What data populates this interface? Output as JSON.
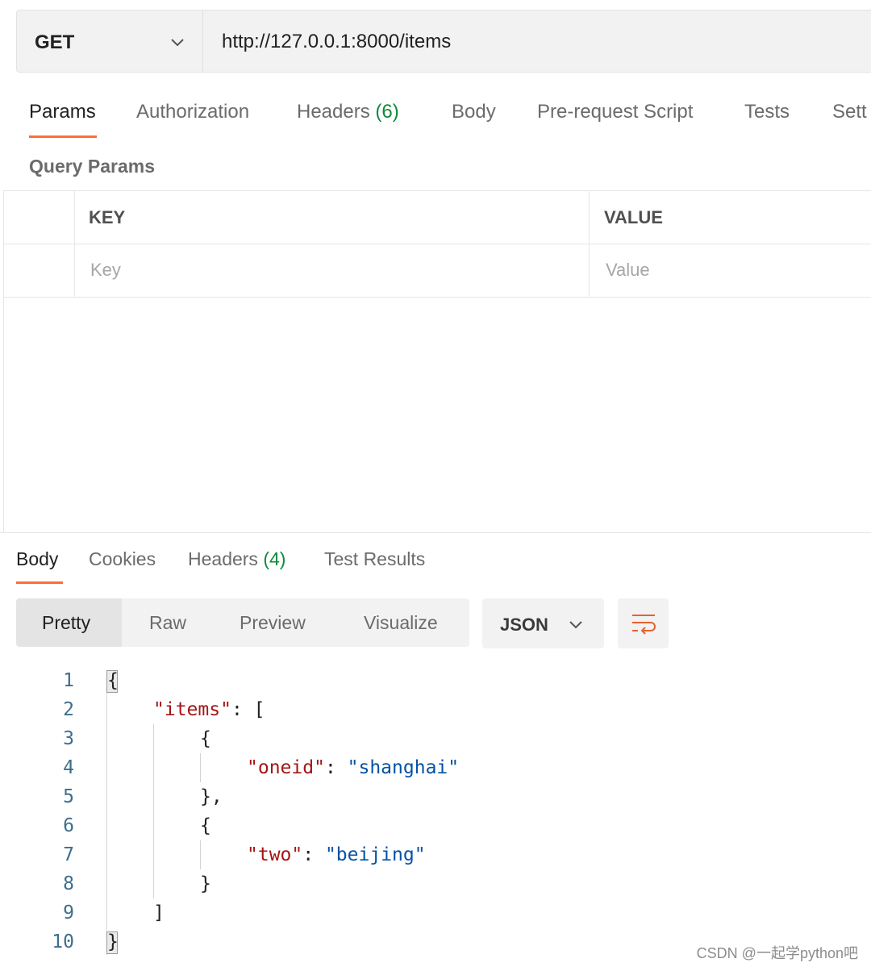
{
  "request": {
    "method": "GET",
    "url": "http://127.0.0.1:8000/items"
  },
  "request_tabs": [
    {
      "label": "Params",
      "count": ""
    },
    {
      "label": "Authorization",
      "count": ""
    },
    {
      "label": "Headers",
      "count": "(6)"
    },
    {
      "label": "Body",
      "count": ""
    },
    {
      "label": "Pre-request Script",
      "count": ""
    },
    {
      "label": "Tests",
      "count": ""
    },
    {
      "label": "Sett",
      "count": ""
    }
  ],
  "query_params": {
    "title": "Query Params",
    "columns": [
      "KEY",
      "VALUE"
    ],
    "key_placeholder": "Key",
    "value_placeholder": "Value"
  },
  "response_tabs": [
    {
      "label": "Body",
      "count": ""
    },
    {
      "label": "Cookies",
      "count": ""
    },
    {
      "label": "Headers",
      "count": "(4)"
    },
    {
      "label": "Test Results",
      "count": ""
    }
  ],
  "view_modes": [
    "Pretty",
    "Raw",
    "Preview",
    "Visualize"
  ],
  "format": "JSON",
  "code_lines": [
    {
      "n": "1",
      "text": "{"
    },
    {
      "n": "2",
      "key": "\"items\"",
      "after": ": ["
    },
    {
      "n": "3",
      "text": "{"
    },
    {
      "n": "4",
      "key": "\"oneid\"",
      "sep": ": ",
      "val": "\"shanghai\""
    },
    {
      "n": "5",
      "text": "},"
    },
    {
      "n": "6",
      "text": "{"
    },
    {
      "n": "7",
      "key": "\"two\"",
      "sep": ": ",
      "val": "\"beijing\""
    },
    {
      "n": "8",
      "text": "}"
    },
    {
      "n": "9",
      "text": "]"
    },
    {
      "n": "10",
      "text": "}"
    }
  ],
  "watermark": "CSDN @一起学python吧",
  "colors": {
    "accent": "#ff6c37",
    "count_green": "#0f8a3a",
    "json_key": "#a31515",
    "json_string": "#0451a5"
  }
}
